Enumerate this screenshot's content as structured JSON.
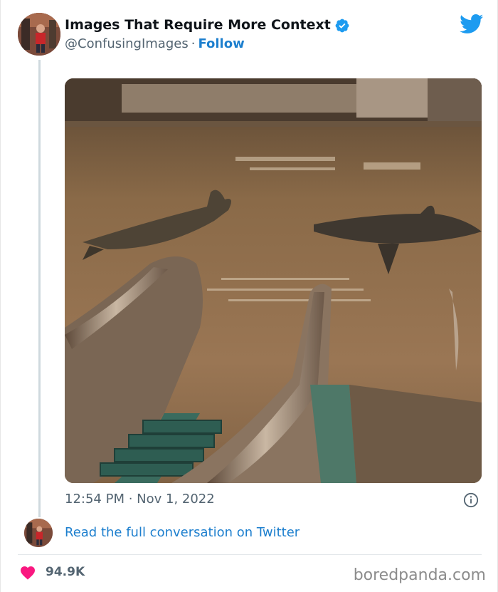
{
  "tweet": {
    "author_name": "Images That Require More Context",
    "handle": "@ConfusingImages",
    "separator": "·",
    "follow_label": "Follow",
    "timestamp": "12:54 PM · Nov 1, 2022",
    "read_link": "Read the full conversation on Twitter",
    "likes": "94.9K",
    "photo_alt": "Flooded mall with sharks swimming near submerged escalators"
  },
  "icons": {
    "verified": "verified-badge-icon",
    "bird": "twitter-bird-icon",
    "info": "info-icon",
    "heart": "heart-icon"
  },
  "colors": {
    "twitter_blue": "#1d9bf0",
    "link_blue": "#1d7fce",
    "heart_pink": "#f91880",
    "secondary_text": "#536471"
  },
  "watermark": "boredpanda.com"
}
